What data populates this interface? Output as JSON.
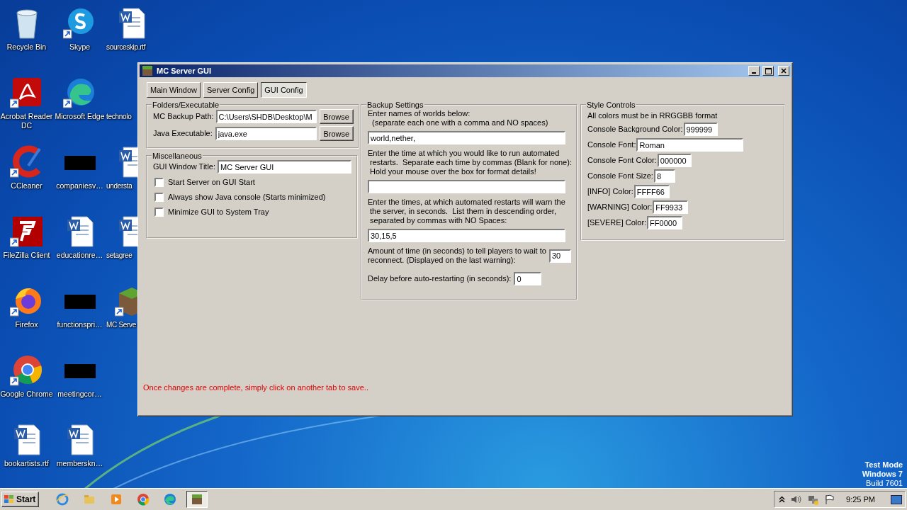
{
  "desktop": {
    "icon_columns": [
      [
        {
          "label": "Recycle Bin",
          "kind": "recycle-bin"
        },
        {
          "label": "Acrobat Reader DC",
          "kind": "acrobat"
        },
        {
          "label": "CCleaner",
          "kind": "ccleaner"
        },
        {
          "label": "FileZilla Client",
          "kind": "filezilla"
        },
        {
          "label": "Firefox",
          "kind": "firefox"
        },
        {
          "label": "Google Chrome",
          "kind": "chrome"
        },
        {
          "label": "bookartists.rtf",
          "kind": "document"
        }
      ],
      [
        {
          "label": "Skype",
          "kind": "skype"
        },
        {
          "label": "Microsoft Edge",
          "kind": "edge"
        },
        {
          "label": "companiesv…",
          "kind": "thumbnail"
        },
        {
          "label": "educationre…",
          "kind": "document"
        },
        {
          "label": "functionspri…",
          "kind": "thumbnail"
        },
        {
          "label": "meetingcor…",
          "kind": "thumbnail"
        },
        {
          "label": "memberskn…",
          "kind": "document"
        }
      ],
      [
        {
          "label": "sourceskip.rtf",
          "kind": "document"
        },
        {
          "label": "technolo",
          "kind": "none"
        },
        {
          "label": "understa",
          "kind": "document"
        },
        {
          "label": "setagree",
          "kind": "document"
        },
        {
          "label": "MC Serve",
          "kind": "minecraft"
        }
      ]
    ]
  },
  "window": {
    "title": "MC Server GUI",
    "tabs": [
      {
        "label": "Main Window",
        "selected": false
      },
      {
        "label": "Server Config",
        "selected": false
      },
      {
        "label": "GUI Config",
        "selected": true
      }
    ],
    "folders": {
      "title": "Folders/Executable",
      "rows": [
        {
          "label": "MC Backup Path:",
          "value": "C:\\Users\\SHDB\\Desktop\\M",
          "button": "Browse"
        },
        {
          "label": "Java Executable:",
          "value": "java.exe",
          "button": "Browse"
        }
      ]
    },
    "misc": {
      "title": "Miscellaneous",
      "field": {
        "label": "GUI Window Title:",
        "value": "MC Server GUI"
      },
      "checkboxes": [
        {
          "label": "Start Server on GUI Start",
          "checked": false
        },
        {
          "label": "Always show Java console (Starts minimized)",
          "checked": false
        },
        {
          "label": "Minimize GUI to System Tray",
          "checked": false
        }
      ]
    },
    "backup": {
      "title": "Backup Settings",
      "items": [
        {
          "kind": "wide",
          "prompt": "Enter names of worlds below:\n  (separate each one with a comma and NO spaces)",
          "value": "world,nether,"
        },
        {
          "kind": "wide",
          "prompt": "Enter the time at which you would like to run automated\n restarts.  Separate each time by commas (Blank for none):\n Hold your mouse over the box for format details!"
        },
        {
          "kind": "wide",
          "prompt": "Enter the times, at which automated restarts will warn the\n the server, in seconds.  List them in descending order,\n separated by commas with NO Spaces:",
          "value": "30,15,5"
        },
        {
          "kind": "inline",
          "prompt": "Amount of time (in seconds) to tell players to wait to\nreconnect. (Displayed on the last warning):",
          "value": "30"
        },
        {
          "kind": "inline",
          "prompt": "Delay before auto-restarting (in seconds):",
          "value": "0"
        }
      ]
    },
    "style": {
      "title": "Style Controls",
      "note": "All colors must be in RRGGBB format",
      "fields": [
        {
          "label": "Console Background Color:",
          "value": "999999"
        },
        {
          "label": "Console Font:",
          "value": "Roman"
        },
        {
          "label": "Console Font Color:",
          "value": "000000"
        },
        {
          "label": "Console Font Size:",
          "value": "8"
        },
        {
          "label": "[INFO] Color:",
          "value": "FFFF66"
        },
        {
          "label": "[WARNING] Color:",
          "value": "FF9933"
        },
        {
          "label": "[SEVERE] Color:",
          "value": "FF0000"
        }
      ]
    },
    "status_message": "Once changes are complete, simply click on another tab to save.."
  },
  "os_notice": [
    "Test Mode",
    "Windows 7",
    "Build 7601"
  ],
  "taskbar": {
    "start": "Start",
    "apps": [
      {
        "kind": "ie",
        "active": false
      },
      {
        "kind": "explorer",
        "active": false
      },
      {
        "kind": "media",
        "active": false
      },
      {
        "kind": "chrome",
        "active": false
      },
      {
        "kind": "edge",
        "active": false
      },
      {
        "kind": "minecraft",
        "active": true
      }
    ],
    "clock": "9:25 PM"
  }
}
